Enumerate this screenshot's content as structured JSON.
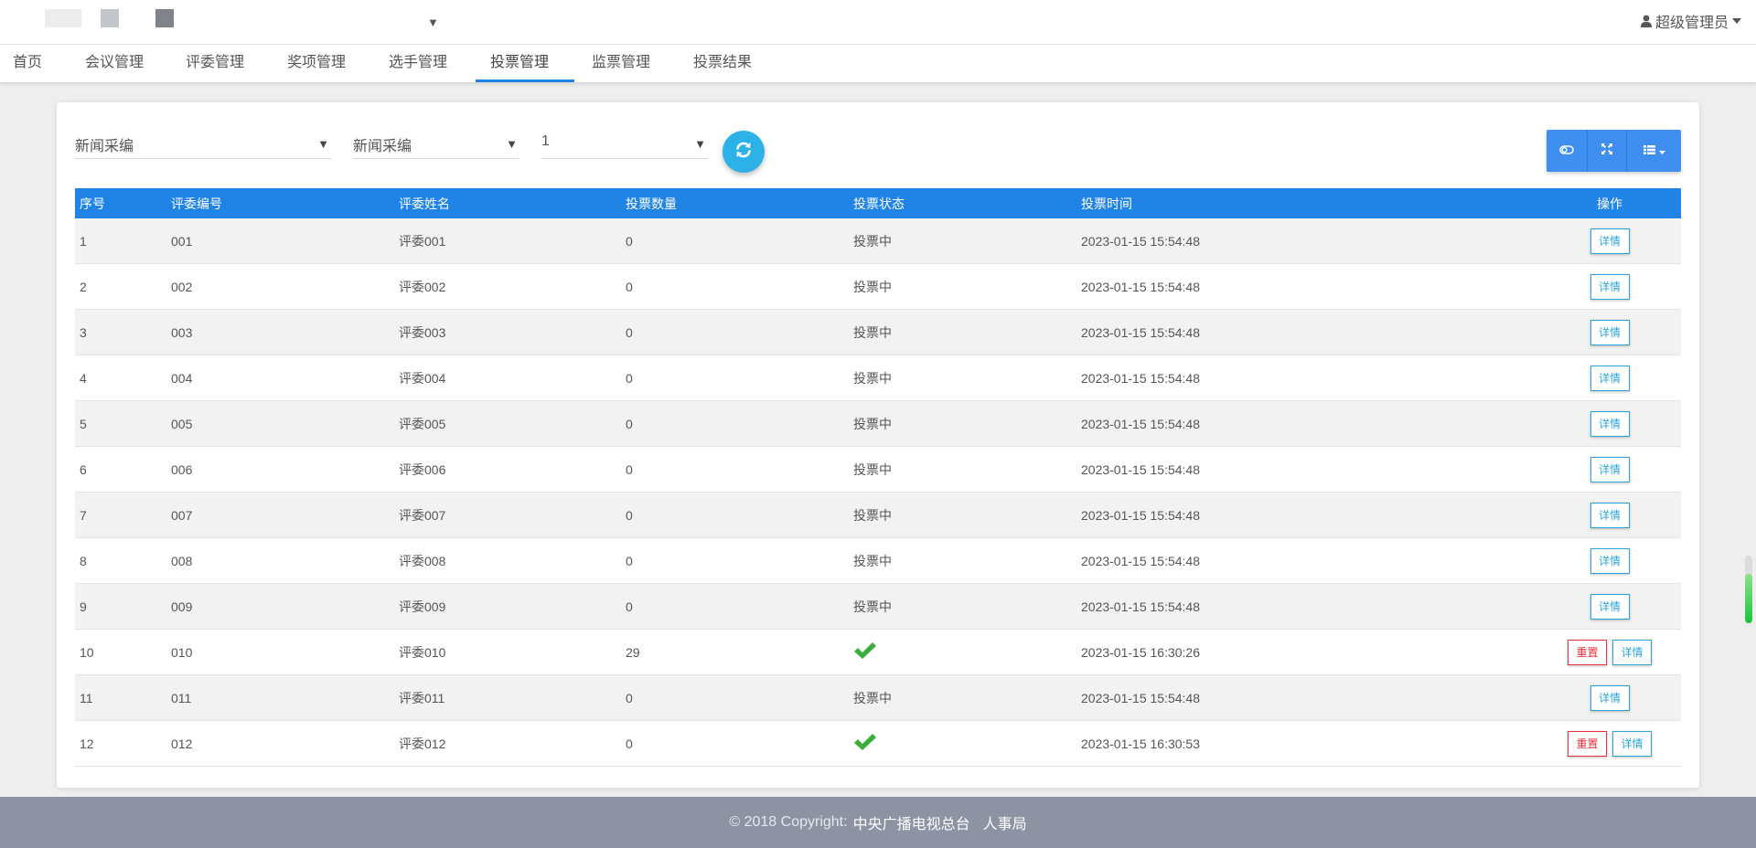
{
  "header": {
    "user_label": "超级管理员",
    "user_icon": "user-icon",
    "caret": "▼"
  },
  "nav": {
    "items": [
      "首页",
      "会议管理",
      "评委管理",
      "奖项管理",
      "选手管理",
      "投票管理",
      "监票管理",
      "投票结果"
    ],
    "active": "投票管理"
  },
  "filters": {
    "select1": "新闻采编",
    "select2": "新闻采编",
    "select3": "1",
    "caret": "▼",
    "refresh_icon": "refresh-icon"
  },
  "toolbar": {
    "buttons": [
      "toggle-icon",
      "fullscreen-icon",
      "columns-icon"
    ]
  },
  "table": {
    "columns": [
      "序号",
      "评委编号",
      "评委姓名",
      "投票数量",
      "投票状态",
      "投票时间",
      "操作"
    ],
    "rows": [
      {
        "seq": "1",
        "code": "001",
        "name": "评委001",
        "count": "0",
        "status": "投票中",
        "time": "2023-01-15 15:54:48",
        "voted": false
      },
      {
        "seq": "2",
        "code": "002",
        "name": "评委002",
        "count": "0",
        "status": "投票中",
        "time": "2023-01-15 15:54:48",
        "voted": false
      },
      {
        "seq": "3",
        "code": "003",
        "name": "评委003",
        "count": "0",
        "status": "投票中",
        "time": "2023-01-15 15:54:48",
        "voted": false
      },
      {
        "seq": "4",
        "code": "004",
        "name": "评委004",
        "count": "0",
        "status": "投票中",
        "time": "2023-01-15 15:54:48",
        "voted": false
      },
      {
        "seq": "5",
        "code": "005",
        "name": "评委005",
        "count": "0",
        "status": "投票中",
        "time": "2023-01-15 15:54:48",
        "voted": false
      },
      {
        "seq": "6",
        "code": "006",
        "name": "评委006",
        "count": "0",
        "status": "投票中",
        "time": "2023-01-15 15:54:48",
        "voted": false
      },
      {
        "seq": "7",
        "code": "007",
        "name": "评委007",
        "count": "0",
        "status": "投票中",
        "time": "2023-01-15 15:54:48",
        "voted": false
      },
      {
        "seq": "8",
        "code": "008",
        "name": "评委008",
        "count": "0",
        "status": "投票中",
        "time": "2023-01-15 15:54:48",
        "voted": false
      },
      {
        "seq": "9",
        "code": "009",
        "name": "评委009",
        "count": "0",
        "status": "投票中",
        "time": "2023-01-15 15:54:48",
        "voted": false
      },
      {
        "seq": "10",
        "code": "010",
        "name": "评委010",
        "count": "29",
        "status": "",
        "time": "2023-01-15 16:30:26",
        "voted": true
      },
      {
        "seq": "11",
        "code": "011",
        "name": "评委011",
        "count": "0",
        "status": "投票中",
        "time": "2023-01-15 15:54:48",
        "voted": false
      },
      {
        "seq": "12",
        "code": "012",
        "name": "评委012",
        "count": "0",
        "status": "",
        "time": "2023-01-15 16:30:53",
        "voted": true
      }
    ],
    "detail_label": "详情",
    "reset_label": "重置",
    "check_color": "#3cae3c"
  },
  "colors": {
    "accent": "#1f84e6",
    "refresh": "#2cb2e6",
    "reset": "#e8303c",
    "footer": "#8d93a3"
  },
  "footer": {
    "copyright": "© 2018 Copyright:",
    "org1": "中央广播电视总台",
    "org2": "人事局"
  }
}
